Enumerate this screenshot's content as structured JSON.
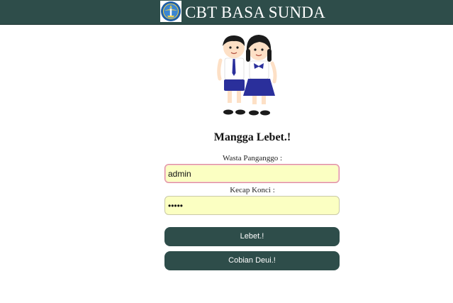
{
  "header": {
    "logo_icon": "tut-wuri-handayani-logo",
    "title": "CBT BASA SUNDA"
  },
  "illustration": {
    "icon": "students-illustration"
  },
  "login": {
    "heading": "Mangga Lebet.!",
    "username_label": "Wasta Panganggo :",
    "username_value": "admin",
    "password_label": "Kecap Konci :",
    "password_value": "admin",
    "submit_label": "Lebet.!",
    "reset_label": "Cobian Deui.!"
  },
  "colors": {
    "header_bg": "#2e4d4a",
    "button_bg": "#2e4d4a",
    "input_bg": "#fbffc2"
  }
}
